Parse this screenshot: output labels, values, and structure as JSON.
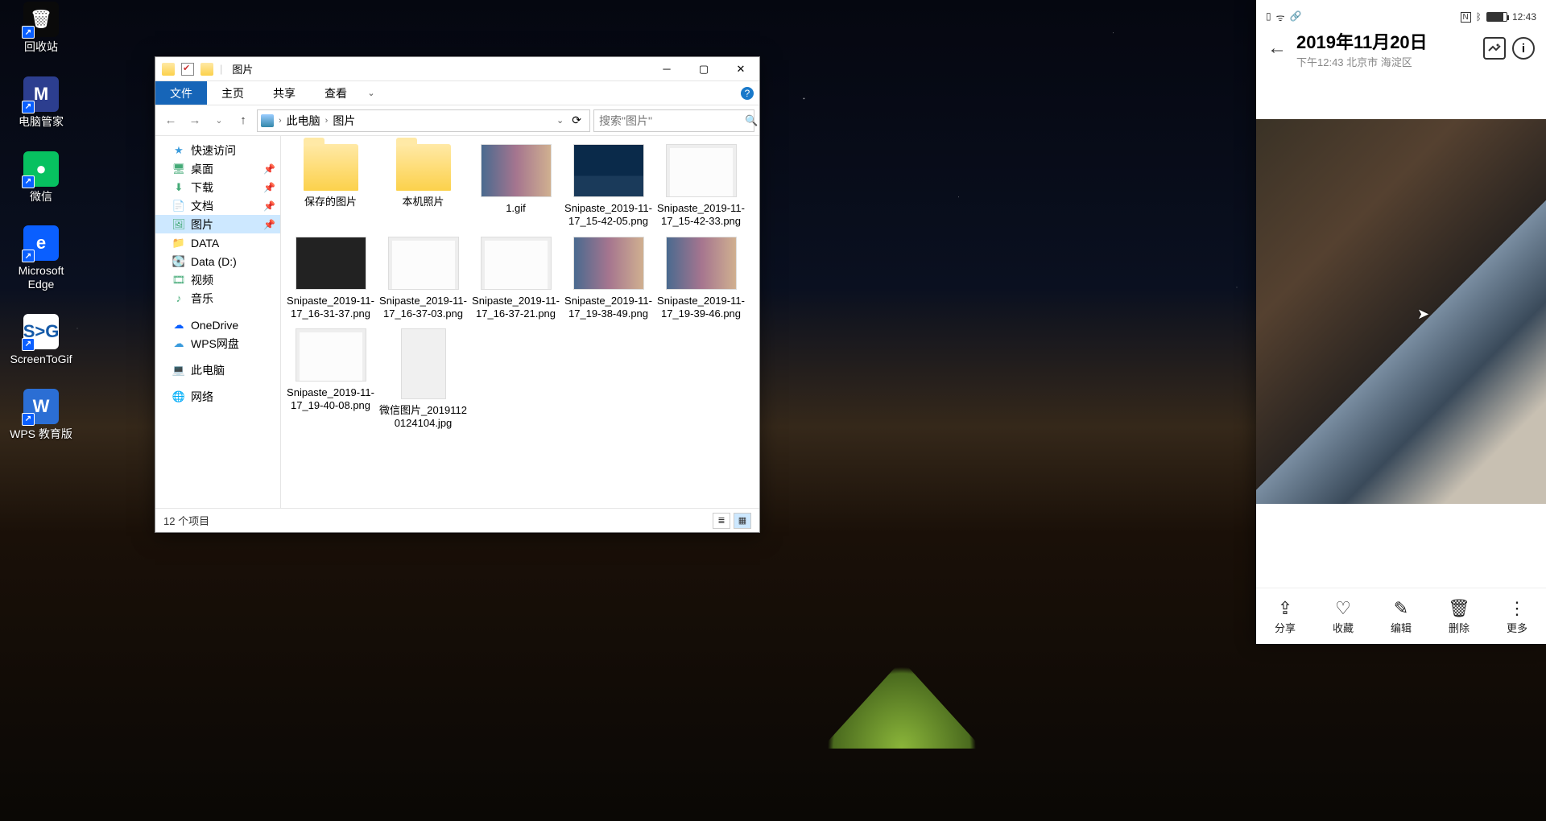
{
  "desktop_icons": [
    {
      "label": "回收站",
      "bg": "#0a0a0a",
      "glyph": "🗑"
    },
    {
      "label": "电脑管家",
      "bg": "#2c3e8f",
      "glyph": "M"
    },
    {
      "label": "微信",
      "bg": "#07c160",
      "glyph": "●"
    },
    {
      "label": "Microsoft Edge",
      "bg": "#0a5fff",
      "glyph": "e"
    },
    {
      "label": "ScreenToGif",
      "bg": "#ffffff",
      "glyph": "S>G",
      "fg": "#155aa8"
    },
    {
      "label": "WPS 教育版",
      "bg": "#2b6ed4",
      "glyph": "W"
    }
  ],
  "explorer": {
    "title": "图片",
    "ribbon_file": "文件",
    "ribbon_tabs": [
      "主页",
      "共享",
      "查看"
    ],
    "breadcrumbs": [
      "此电脑",
      "图片"
    ],
    "search_placeholder": "搜索\"图片\"",
    "status_text": "12 个项目",
    "side": [
      {
        "kind": "hdr",
        "icon": "★",
        "label": "快速访问",
        "color": "#3a9bdc"
      },
      {
        "kind": "pin",
        "icon": "🖥",
        "label": "桌面"
      },
      {
        "kind": "pin",
        "icon": "⬇",
        "label": "下载"
      },
      {
        "kind": "pin",
        "icon": "📄",
        "label": "文档"
      },
      {
        "kind": "pin",
        "icon": "🖼",
        "label": "图片",
        "selected": true
      },
      {
        "kind": "itm",
        "icon": "📁",
        "label": "DATA"
      },
      {
        "kind": "itm",
        "icon": "💽",
        "label": "Data (D:)"
      },
      {
        "kind": "itm",
        "icon": "🎞",
        "label": "视频"
      },
      {
        "kind": "itm",
        "icon": "♪",
        "label": "音乐"
      },
      {
        "kind": "sp"
      },
      {
        "kind": "itm",
        "icon": "☁",
        "label": "OneDrive",
        "color": "#0a5fff"
      },
      {
        "kind": "itm",
        "icon": "☁",
        "label": "WPS网盘",
        "color": "#3a9bdc"
      },
      {
        "kind": "sp"
      },
      {
        "kind": "itm",
        "icon": "💻",
        "label": "此电脑"
      },
      {
        "kind": "sp"
      },
      {
        "kind": "itm",
        "icon": "🌐",
        "label": "网络"
      }
    ],
    "files": [
      {
        "name": "保存的图片",
        "type": "folder"
      },
      {
        "name": "本机照片",
        "type": "folder"
      },
      {
        "name": "1.gif",
        "type": "img",
        "variant": "anim"
      },
      {
        "name": "Snipaste_2019-11-17_15-42-05.png",
        "type": "img",
        "variant": "desk"
      },
      {
        "name": "Snipaste_2019-11-17_15-42-33.png",
        "type": "img",
        "variant": "doc"
      },
      {
        "name": "Snipaste_2019-11-17_16-31-37.png",
        "type": "img",
        "variant": "dark"
      },
      {
        "name": "Snipaste_2019-11-17_16-37-03.png",
        "type": "img",
        "variant": "doc"
      },
      {
        "name": "Snipaste_2019-11-17_16-37-21.png",
        "type": "img",
        "variant": "doc"
      },
      {
        "name": "Snipaste_2019-11-17_19-38-49.png",
        "type": "img",
        "variant": "anim"
      },
      {
        "name": "Snipaste_2019-11-17_19-39-46.png",
        "type": "img",
        "variant": "anim"
      },
      {
        "name": "Snipaste_2019-11-17_19-40-08.png",
        "type": "img",
        "variant": "doc"
      },
      {
        "name": "微信图片_201911201241​04.jpg",
        "type": "img",
        "variant": "tall"
      }
    ]
  },
  "phone": {
    "status_time": "12:43",
    "title": "2019年11月20日",
    "subtitle": "下午12:43 北京市 海淀区",
    "toolbar": [
      {
        "icon": "share-icon",
        "glyph": "⇪",
        "label": "分享"
      },
      {
        "icon": "heart-icon",
        "glyph": "♡",
        "label": "收藏"
      },
      {
        "icon": "edit-icon",
        "glyph": "✎",
        "label": "编辑"
      },
      {
        "icon": "delete-icon",
        "glyph": "🗑",
        "label": "删除"
      },
      {
        "icon": "more-icon",
        "glyph": "⋮",
        "label": "更多"
      }
    ]
  }
}
